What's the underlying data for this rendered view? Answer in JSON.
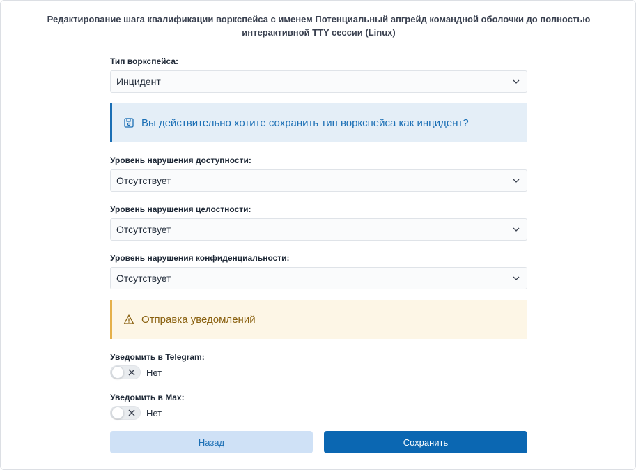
{
  "header": {
    "title": "Редактирование шага квалификации воркспейса с именем Потенциальный апгрейд командной оболочки до полностью интерактивной TTY сессии (Linux)"
  },
  "form": {
    "workspace_type": {
      "label": "Тип воркспейса:",
      "value": "Инцидент"
    },
    "info_alert": {
      "text": "Вы действительно хотите сохранить тип воркспейса как инцидент?",
      "icon": "save-icon"
    },
    "availability": {
      "label": "Уровень нарушения доступности:",
      "value": "Отсутствует"
    },
    "integrity": {
      "label": "Уровень нарушения целостности:",
      "value": "Отсутствует"
    },
    "confidentiality": {
      "label": "Уровень нарушения конфиденциальности:",
      "value": "Отсутствует"
    },
    "warn_alert": {
      "text": "Отправка уведомлений",
      "icon": "warning-icon"
    },
    "telegram": {
      "label": "Уведомить в Telegram:",
      "state_text": "Нет",
      "enabled": false
    },
    "max": {
      "label": "Уведомить в Max:",
      "state_text": "Нет",
      "enabled": false
    }
  },
  "buttons": {
    "back_label": "Назад",
    "save_label": "Сохранить"
  },
  "colors": {
    "primary": "#0b67b2",
    "info_bg": "#e4eef7",
    "warn_bg": "#fdf6e6",
    "warn_border": "#e5b04a"
  }
}
